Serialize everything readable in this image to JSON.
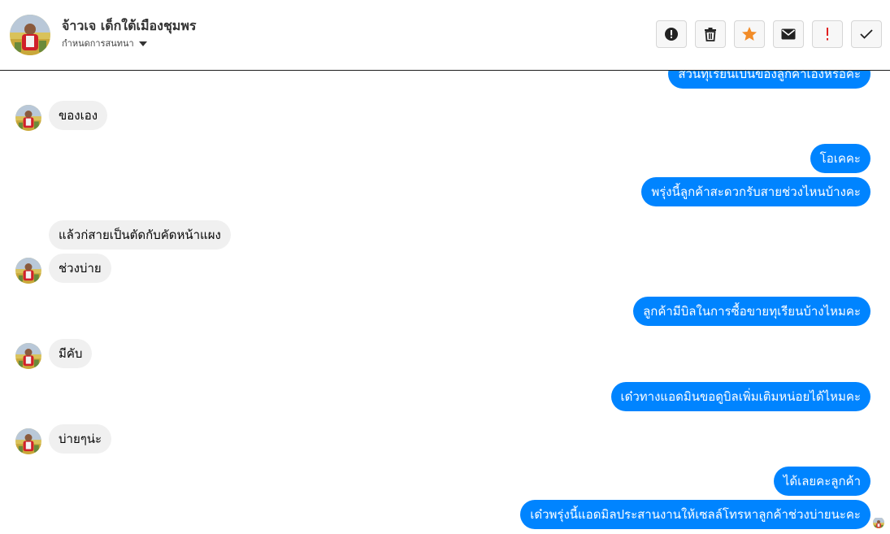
{
  "header": {
    "contact_name": "จ้าวเจ เด็กใต้เมืองชุมพร",
    "settings_label": "กำหนดการสนทนา",
    "toolbar": [
      {
        "icon": "alert-circle-icon"
      },
      {
        "icon": "trash-icon"
      },
      {
        "icon": "star-icon"
      },
      {
        "icon": "envelope-icon"
      },
      {
        "icon": "exclamation-icon"
      },
      {
        "icon": "checkmark-icon"
      }
    ]
  },
  "messages": [
    {
      "from": "page",
      "text": "ส่วนทุเรียนเป็นของลูกค้าเองหรือคะ"
    },
    {
      "from": "customer",
      "text": "ของเอง"
    },
    {
      "from": "page",
      "text": "โอเคคะ"
    },
    {
      "from": "page",
      "text": "พรุ่งนี้ลูกค้าสะดวกรับสายช่วงไหนบ้างคะ"
    },
    {
      "from": "customer",
      "text": "แล้วก่สายเป็นตัดกับคัดหน้าแผง"
    },
    {
      "from": "customer",
      "text": "ช่วงบ่าย"
    },
    {
      "from": "page",
      "text": "ลูกค้ามีบิลในการซื้อขายทุเรียนบ้างไหมคะ"
    },
    {
      "from": "customer",
      "text": "มีคับ"
    },
    {
      "from": "page",
      "text": "เด๋วทางแอดมินขอดูบิลเพิ่มเติมหน่อยได้ไหมคะ"
    },
    {
      "from": "customer",
      "text": "บ่ายๆน่ะ"
    },
    {
      "from": "page",
      "text": "ได้เลยคะลูกค้า"
    },
    {
      "from": "page",
      "text": "เด๋วพรุ่งนี้แอดมิลประสานงานให้เซลล์โทรหาลูกค้าช่วงบ่ายนะคะ"
    }
  ],
  "colors": {
    "outgoing_bubble": "#0084ff",
    "incoming_bubble": "#f0f0f0",
    "star": "#f28c28",
    "exclamation": "#e02020"
  }
}
